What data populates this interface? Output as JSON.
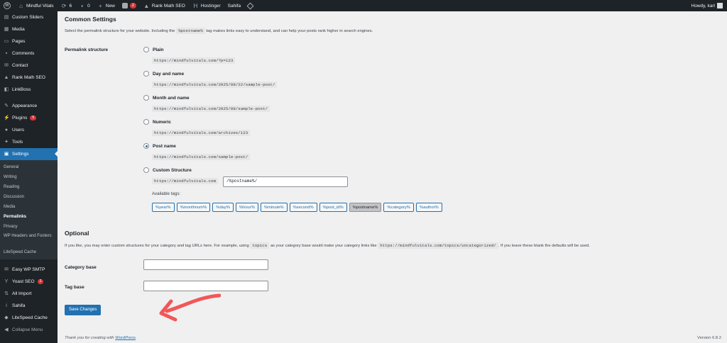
{
  "adminbar": {
    "site_name": "Mindful Vitals",
    "updates_count": "6",
    "comments_count": "0",
    "new_label": "New",
    "yoast_count": "2",
    "rankmath_label": "Rank Math SEO",
    "hostinger_label": "Hostinger",
    "sahifa_label": "Sahifa",
    "howdy": "Howdy, karl"
  },
  "sidebar": {
    "items_top": [
      {
        "label": "Custom Sliders",
        "icon": "slider-icon"
      },
      {
        "label": "Media",
        "icon": "media-icon"
      },
      {
        "label": "Pages",
        "icon": "page-icon"
      },
      {
        "label": "Comments",
        "icon": "comment-icon"
      },
      {
        "label": "Contact",
        "icon": "mail-icon"
      },
      {
        "label": "Rank Math SEO",
        "icon": "rankmath-icon"
      },
      {
        "label": "LinkBoss",
        "icon": "linkboss-icon"
      }
    ],
    "items_mid": [
      {
        "label": "Appearance",
        "icon": "brush-icon"
      },
      {
        "label": "Plugins",
        "icon": "plugin-icon",
        "badge": "5"
      },
      {
        "label": "Users",
        "icon": "users-icon"
      },
      {
        "label": "Tools",
        "icon": "wrench-icon"
      }
    ],
    "settings_label": "Settings",
    "submenu": [
      "General",
      "Writing",
      "Reading",
      "Discussion",
      "Media",
      "Permalinks",
      "Privacy",
      "WP Headers and Footers",
      "LiteSpeed Cache"
    ],
    "items_bottom": [
      {
        "label": "Easy WP SMTP",
        "icon": "smtp-icon"
      },
      {
        "label": "Yoast SEO",
        "icon": "yoast-icon",
        "badge": "2"
      },
      {
        "label": "All Import",
        "icon": "import-icon"
      },
      {
        "label": "Sahifa",
        "icon": "info-icon"
      },
      {
        "label": "LiteSpeed Cache",
        "icon": "litespeed-icon"
      },
      {
        "label": "Collapse Menu",
        "icon": "collapse-icon"
      }
    ]
  },
  "common": {
    "title": "Common Settings",
    "desc_before": "Select the permalink structure for your website. Including the",
    "desc_code": "%postname%",
    "desc_after": "tag makes links easy to understand, and can help your posts rank higher in search engines.",
    "structure_label": "Permalink structure",
    "options": [
      {
        "label": "Plain",
        "example": "https://mindfulvitals.com/?p=123"
      },
      {
        "label": "Day and name",
        "example": "https://mindfulvitals.com/2025/08/22/sample-post/"
      },
      {
        "label": "Month and name",
        "example": "https://mindfulvitals.com/2025/08/sample-post/"
      },
      {
        "label": "Numeric",
        "example": "https://mindfulvitals.com/archives/123"
      },
      {
        "label": "Post name",
        "example": "https://mindfulvitals.com/sample-post/"
      }
    ],
    "selected": "Post name",
    "custom_label": "Custom Structure",
    "custom_prefix": "https://mindfulvitals.com",
    "custom_value": "/%postname%/",
    "available_tags_label": "Available tags:",
    "tags": [
      "%year%",
      "%monthnum%",
      "%day%",
      "%hour%",
      "%minute%",
      "%second%",
      "%post_id%",
      "%postname%",
      "%category%",
      "%author%"
    ],
    "active_tag": "%postname%"
  },
  "optional": {
    "title": "Optional",
    "desc_before": "If you like, you may enter custom structures for your category and tag URLs here. For example, using",
    "desc_code1": "topics",
    "desc_mid": "as your category base would make your category links like",
    "desc_code2": "https://mindfulvitals.com/topics/uncategorized/",
    "desc_after": ". If you leave these blank the defaults will be used.",
    "category_label": "Category base",
    "category_value": "",
    "tag_label": "Tag base",
    "tag_value": ""
  },
  "save_label": "Save Changes",
  "footer": {
    "thanks_before": "Thank you for creating with",
    "thanks_link": "WordPress",
    "thanks_after": ".",
    "version": "Version 6.8.2"
  },
  "colors": {
    "accent": "#2271b1",
    "arrow": "#f25757"
  }
}
